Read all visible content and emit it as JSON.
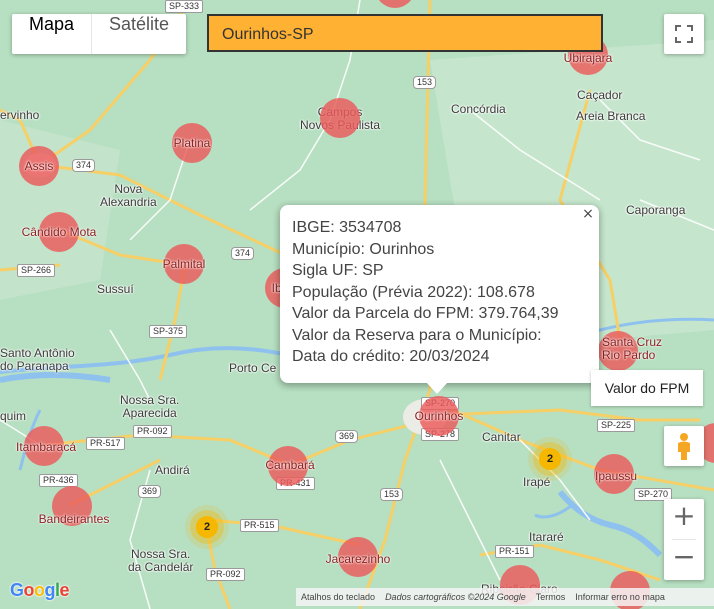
{
  "map_type": {
    "map_label": "Mapa",
    "satellite_label": "Satélite",
    "active": "Mapa"
  },
  "search": {
    "value": "Ourinhos-SP"
  },
  "controls": {
    "fullscreen_icon": "fullscreen-icon",
    "zoom_in": "+",
    "zoom_out": "−",
    "pegman_icon": "pegman-icon"
  },
  "tooltip": {
    "text": "Valor do FPM"
  },
  "info_window": {
    "lines": [
      "IBGE: 3534708",
      "Município: Ourinhos",
      "Sigla UF: SP",
      "População (Prévia 2022): 108.678",
      "Valor da Parcela do FPM: 379.764,39",
      "Valor da Reserva para o Município:",
      "Data do crédito: 20/03/2024"
    ],
    "close": "×"
  },
  "town_labels": {
    "ervinho": "ervinho",
    "campos": "Campos\nNovos Paulista",
    "concordia": "Concórdia",
    "cacador": "Caçador",
    "areia_branca": "Areia Branca",
    "nova_alexandria": "Nova\nAlexandria",
    "caporanga": "Caporanga",
    "sussui": "Sussuí",
    "santo_antonio": "Santo Antônio\ndo Paranapa",
    "porto_ce": "Porto Ce",
    "nossa_sra_aparecida": "Nossa Sra.\nAparecida",
    "quim": "quim",
    "andira": "Andirá",
    "canitar": "Canitar",
    "irape": "Irapé",
    "itarare": "Itararé",
    "nossa_sra_candelar": "Nossa Sra.\nda Candelár",
    "ribeirao_claro": "Ribeirão Claro"
  },
  "road_shields": [
    "SP-333",
    "153",
    "374",
    "374",
    "SP-266",
    "SP-375",
    "SP-270",
    "SP-278",
    "PR-092",
    "PR-517",
    "369",
    "PR-436",
    "369",
    "PR-431",
    "153",
    "PR-515",
    "PR-092",
    "SP-225",
    "SP-270",
    "PR-151"
  ],
  "markers": [
    {
      "label": "Assis"
    },
    {
      "label": "Platina"
    },
    {
      "label": "Cândido Mota"
    },
    {
      "label": "Palmital"
    },
    {
      "label": "Ibi"
    },
    {
      "label": "Ourinhos"
    },
    {
      "label": "Itambaracá"
    },
    {
      "label": "Bandeirantes"
    },
    {
      "label": "Cambará"
    },
    {
      "label": "Jacarezinho"
    },
    {
      "label": "Ipaussu"
    },
    {
      "label": "Ubirajara"
    },
    {
      "label": "Santa Cruz\nRio Pardo"
    }
  ],
  "clusters": [
    {
      "count": "2",
      "near": "Chavantes"
    },
    {
      "count": "2",
      "near": "Barra do Jacaré"
    }
  ],
  "footer": {
    "shortcuts": "Atalhos do teclado",
    "map_data": "Dados cartográficos ©2024 Google",
    "terms": "Termos",
    "report": "Informar erro no mapa"
  },
  "brand": {
    "logo_text": "Google"
  },
  "colors": {
    "land": "#b7dfc1",
    "road": "#ffffff",
    "highway": "#f6cf66",
    "water": "#8fc1ef",
    "marker": "#ec5a5a",
    "cluster": "#f5b700",
    "search_bg": "#ffb133"
  }
}
